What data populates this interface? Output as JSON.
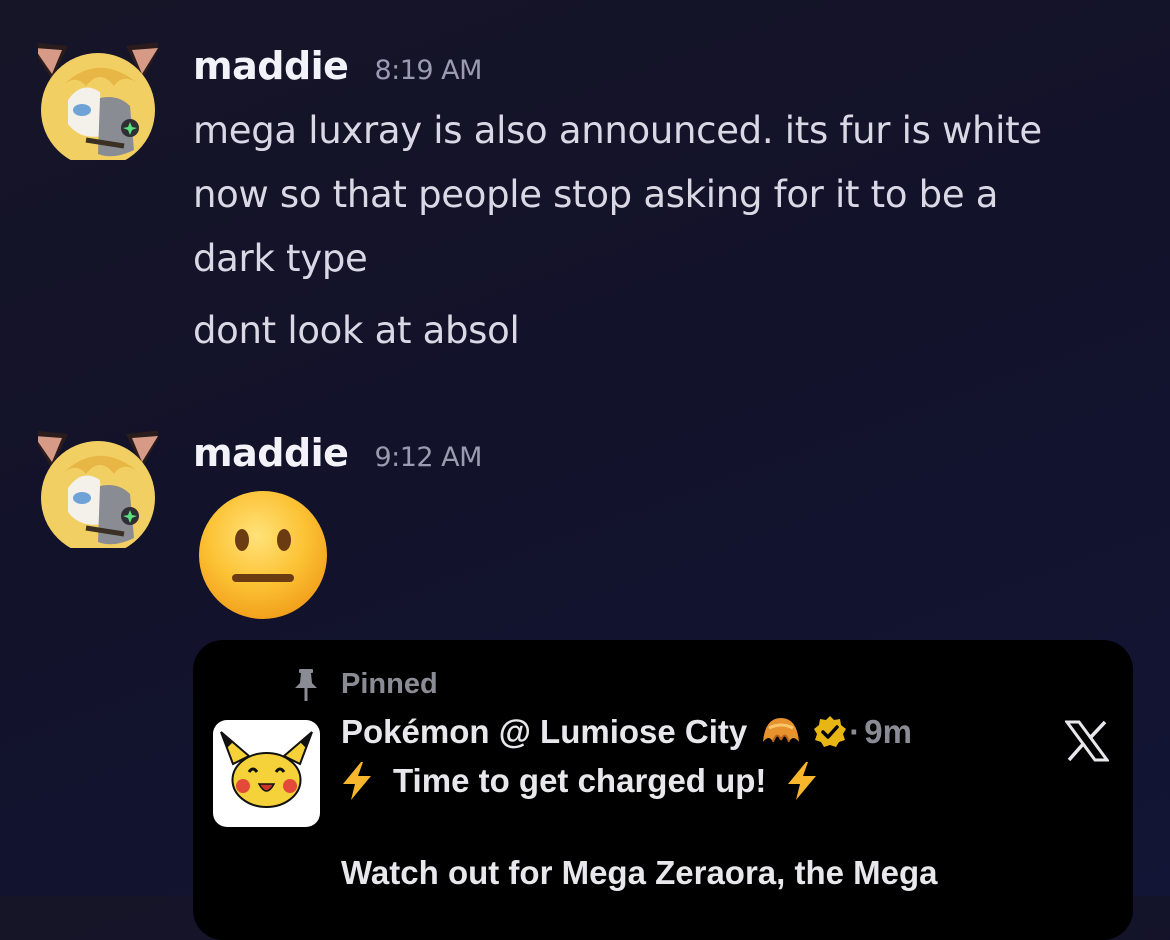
{
  "messages": [
    {
      "username": "maddie",
      "timestamp": "8:19 AM",
      "lines": [
        "mega luxray is also announced. its fur is white",
        "now so that people stop asking for it to be a",
        "dark type"
      ],
      "followup": "dont look at absol"
    },
    {
      "username": "maddie",
      "timestamp": "9:12 AM",
      "emoji": "neutral-face"
    }
  ],
  "embed": {
    "pinned_label": "Pinned",
    "author": "Pokémon @ Lumiose City",
    "author_emoji": "croissant",
    "verified": true,
    "separator": "·",
    "time": "9m",
    "platform_icon": "x-logo",
    "headline": "Time to get charged up!",
    "body_line": "Watch out for Mega Zeraora, the Mega"
  },
  "colors": {
    "background": "#14142c",
    "username": "#f2f2f8",
    "timestamp": "#9a9ab0",
    "embed_bg": "#000000",
    "verified": "#e8b614",
    "muted": "#8b8b95"
  }
}
